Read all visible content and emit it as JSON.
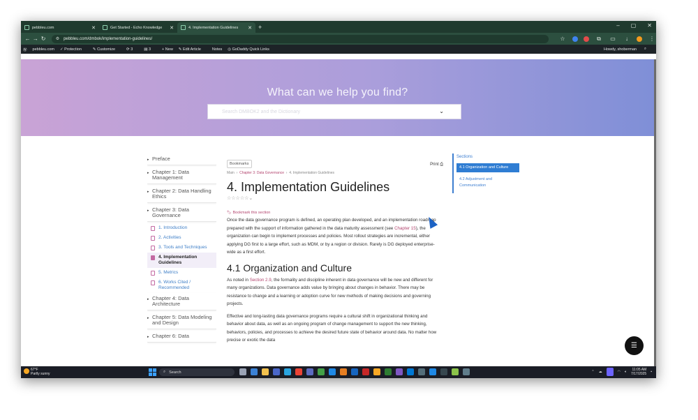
{
  "browser": {
    "tabs": [
      {
        "title": "pebbleu.com",
        "active": false
      },
      {
        "title": "Get Started - Echo Knowledge",
        "active": false
      },
      {
        "title": "4. Implementation Guidelines",
        "active": true
      }
    ],
    "url": "pebbleu.com/dmbok/implementation-guidelines/",
    "window_controls": [
      "–",
      "▢",
      "✕"
    ]
  },
  "wp_admin_bar": {
    "items": [
      "pebbleu.com",
      "Protection",
      "Customize",
      "3",
      "3",
      "+ New",
      "Edit Article",
      "Notes",
      "GoDaddy Quick Links"
    ],
    "howdy": "Howdy, shoberman"
  },
  "hero": {
    "heading": "What can we help you find?",
    "search_placeholder": "Search DMBOK2 and the Dictionary"
  },
  "toc": {
    "chapters_before": [
      "Preface",
      "Chapter 1: Data Management",
      "Chapter 2: Data Handling Ethics",
      "Chapter 3: Data Governance"
    ],
    "articles": [
      {
        "label": "1. Introduction",
        "active": false
      },
      {
        "label": "2. Activities",
        "active": false
      },
      {
        "label": "3. Tools and Techniques",
        "active": false
      },
      {
        "label": "4. Implementation Guidelines",
        "active": true
      },
      {
        "label": "5. Metrics",
        "active": false
      },
      {
        "label": "6. Works Cited / Recommended",
        "active": false
      }
    ],
    "chapters_after": [
      "Chapter 4: Data Architecture",
      "Chapter 5: Data Modeling and Design",
      "Chapter 6: Data"
    ]
  },
  "article": {
    "bookmarks_label": "Bookmarks",
    "breadcrumb": [
      "Main",
      "Chapter 3: Data Governance",
      "4. Implementation Guidelines"
    ],
    "print_label": "Print",
    "title": "4. Implementation Guidelines",
    "stars": "☆☆☆☆☆",
    "bookmark_link": "Bookmark this section",
    "intro_a": "Once the data governance program is defined, an operating plan developed, and an implementation roadmap prepared with the support of information gathered in the data maturity assessment (see ",
    "intro_link": "Chapter 15",
    "intro_b": "), the organization can begin to implement processes and policies. Most rollout strategies are incremental, either applying DG first to a large effort, such as MDM, or by a region or division. Rarely is DG deployed enterprise-wide as a first effort.",
    "h2": "4.1 Organization and Culture",
    "p2_a": "As noted in ",
    "p2_link": "Section 2.9",
    "p2_b": ", the formality and discipline inherent in data governance will be new and different for many organizations. Data governance adds value by bringing about changes in behavior. There may be resistance to change and a learning or adoption curve for new methods of making decisions and governing projects.",
    "p3": "Effective and long-lasting data governance programs require a cultural shift in organizational thinking and behavior about data, as well as an ongoing program of change management to support the new thinking, behaviors, policies, and processes to achieve the desired future state of behavior around data. No matter how precise or exotic the data"
  },
  "sections_panel": {
    "heading": "Sections",
    "items": [
      {
        "label": "4.1 Organization and Culture",
        "active": true
      },
      {
        "label": "4.2 Adjustment and Communication",
        "active": false
      }
    ]
  },
  "taskbar": {
    "temp": "67°F",
    "weather": "Partly sunny",
    "search": "Search",
    "time": "11:05 AM",
    "date": "7/17/2025"
  },
  "colors": {
    "accent": "#2f7dd3",
    "link": "#b3456f",
    "wp_bar": "#1d2327",
    "chrome": "#2c4f3f"
  }
}
